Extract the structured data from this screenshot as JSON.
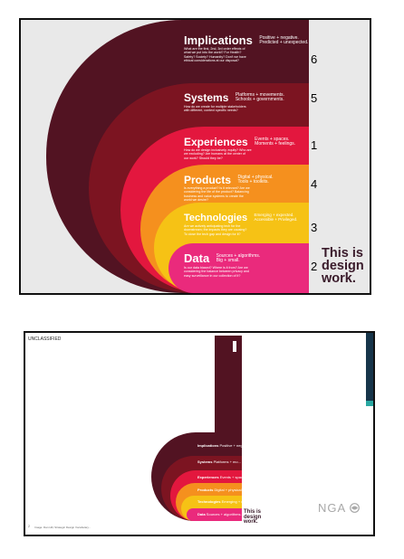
{
  "slide1": {
    "layers": [
      {
        "key": "implications",
        "title": "Implications",
        "subtitle_lines": [
          "Positive + negative.",
          "Predicted + unexpected."
        ],
        "desc_lines": [
          "What are the first, 2nd, 3rd order effects of",
          "what we put into the world? For Health?",
          "Safety? Society? Humanity? Don't we have",
          "ethical considerations at our disposal?"
        ],
        "number": "6",
        "color": "#521322"
      },
      {
        "key": "systems",
        "title": "Systems",
        "subtitle_lines": [
          "Platforms + movements.",
          "Schools + governments."
        ],
        "desc_lines": [
          "How do we create for multiple stakeholders",
          "with different, context specific needs?"
        ],
        "number": "5",
        "color": "#7c1421"
      },
      {
        "key": "experiences",
        "title": "Experiences",
        "subtitle_lines": [
          "Events + spaces.",
          "Moments + feelings."
        ],
        "desc_lines": [
          "How do we design inclusively, equity? Who are",
          "we excluding? Are humans at the center of",
          "our work? Should they be?"
        ],
        "number": "1",
        "color": "#e3173e"
      },
      {
        "key": "products",
        "title": "Products",
        "subtitle_lines": [
          "Digital + physical.",
          "Tools + toolkits."
        ],
        "desc_lines": [
          "Is everything a product? Is it relevant? Are we",
          "considering the life of the product? Balancing",
          "business and value systems to create the",
          "world we desire?"
        ],
        "number": "4",
        "color": "#f5901e"
      },
      {
        "key": "technologies",
        "title": "Technologies",
        "subtitle_lines": [
          "Emerging + expected.",
          "Accessible + Privileged."
        ],
        "desc_lines": [
          "Are we actively anticipating tech for the",
          "downstream; the impacts they are causing?",
          "To close the tech gap and design for it?"
        ],
        "number": "3",
        "color": "#f6c215"
      },
      {
        "key": "data",
        "title": "Data",
        "subtitle_lines": [
          "Sources + algorithms.",
          "Big + small."
        ],
        "desc_lines": [
          "Is our data biased? Where is it from? Are we",
          "considering the balance between privacy and",
          "easy surveillance in our collection of it?"
        ],
        "number": "2",
        "color": "#ea2a7c"
      }
    ],
    "tagline": "This is design work."
  },
  "slide2": {
    "header": "UNCLASSIFIED",
    "layers": [
      {
        "key": "implications",
        "title": "Implications",
        "subtitle": "Positive + negative.",
        "color": "#521322"
      },
      {
        "key": "systems",
        "title": "Systems",
        "subtitle": "Platforms + mo...",
        "color": "#7c1421"
      },
      {
        "key": "experiences",
        "title": "Experiences",
        "subtitle": "Events + spaces.",
        "color": "#e3173e"
      },
      {
        "key": "products",
        "title": "Products",
        "subtitle": "Digital + physical.",
        "color": "#f5901e"
      },
      {
        "key": "technologies",
        "title": "Technologies",
        "subtitle": "Emerging + expected.",
        "color": "#f6c215"
      },
      {
        "key": "data",
        "title": "Data",
        "subtitle": "Sources + algorithms.",
        "color": "#ea2a7c"
      }
    ],
    "tagline": "This is design work.",
    "logo": "NGA",
    "footer_caption": "Image: Dan Hill, Strategic Design Vocabulary...",
    "page_number": "2"
  }
}
